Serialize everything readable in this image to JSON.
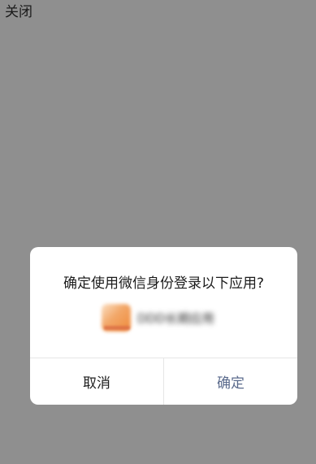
{
  "header": {
    "close_label": "关闭"
  },
  "dialog": {
    "title": "确定使用微信身份登录以下应用?",
    "app": {
      "icon": "app-icon",
      "caption": "",
      "name": "DDD长期应用"
    },
    "cancel_label": "取消",
    "confirm_label": "确定"
  },
  "colors": {
    "overlay": "#8f8f8f",
    "dialog_bg": "#ffffff",
    "confirm_text": "#5a6a8c",
    "divider": "#e6e6e6"
  }
}
